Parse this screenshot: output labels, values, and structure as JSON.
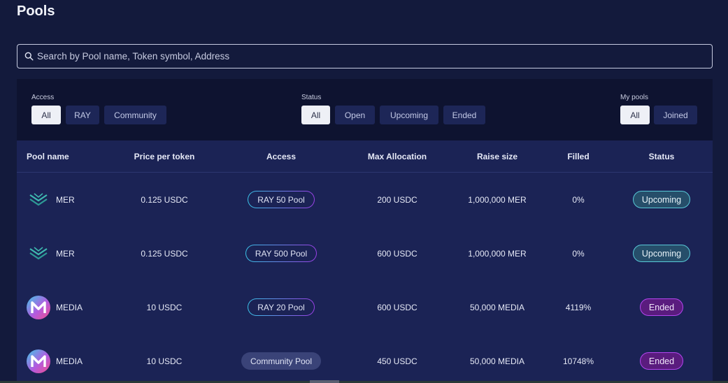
{
  "page": {
    "title": "Pools"
  },
  "search": {
    "placeholder": "Search by Pool name, Token symbol, Address"
  },
  "filters": {
    "access": {
      "label": "Access",
      "options": [
        "All",
        "RAY",
        "Community"
      ],
      "selected": "All"
    },
    "status": {
      "label": "Status",
      "options": [
        "All",
        "Open",
        "Upcoming",
        "Ended"
      ],
      "selected": "All"
    },
    "my_pools": {
      "label": "My pools",
      "options": [
        "All",
        "Joined"
      ],
      "selected": "All"
    }
  },
  "table": {
    "headers": {
      "pool_name": "Pool name",
      "price": "Price per token",
      "access": "Access",
      "max_allocation": "Max Allocation",
      "raise_size": "Raise size",
      "filled": "Filled",
      "status": "Status"
    },
    "rows": [
      {
        "logo": "mer-logo-icon",
        "name": "MER",
        "price": "0.125 USDC",
        "access": "RAY 50 Pool",
        "access_type": "ray",
        "max_allocation": "200 USDC",
        "raise_size": "1,000,000 MER",
        "filled": "0%",
        "status": "Upcoming"
      },
      {
        "logo": "mer-logo-icon",
        "name": "MER",
        "price": "0.125 USDC",
        "access": "RAY 500 Pool",
        "access_type": "ray",
        "max_allocation": "600 USDC",
        "raise_size": "1,000,000 MER",
        "filled": "0%",
        "status": "Upcoming"
      },
      {
        "logo": "media-logo-icon",
        "name": "MEDIA",
        "price": "10 USDC",
        "access": "RAY 20 Pool",
        "access_type": "ray",
        "max_allocation": "600 USDC",
        "raise_size": "50,000 MEDIA",
        "filled": "4119%",
        "status": "Ended"
      },
      {
        "logo": "media-logo-icon",
        "name": "MEDIA",
        "price": "10 USDC",
        "access": "Community Pool",
        "access_type": "community",
        "max_allocation": "450 USDC",
        "raise_size": "50,000 MEDIA",
        "filled": "10748%",
        "status": "Ended"
      }
    ]
  },
  "colors": {
    "background": "#131a3c",
    "panel": "#0e1330",
    "table": "#1b2355",
    "upcoming": "#58c9d8",
    "ended": "#b445f0"
  }
}
